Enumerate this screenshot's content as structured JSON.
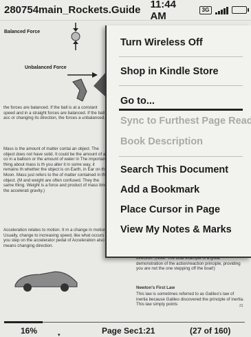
{
  "status": {
    "book_title": "280754main_Rockets.Guide",
    "time": "11:44 AM",
    "network_label": "3G"
  },
  "page": {
    "balanced_label": "Balanced Force",
    "unbalanced_label": "Unbalanced Force",
    "left_paragraphs": [
      "the forces are balanced. If the ball is at a constant speed and in a straight forces are balanced. If the ball is acc or changing its direction, the forces a unbalanced.",
      "Mass is the amount of matter contai an object. The object does not have solid. It could be the amount of air co in a balloon or the amount of water in The important thing about mass is th you alter it in some way, it remains th whether the object is on Earth, in Ear on the Moon. Mass just refers to the of matter contained in the object. (M and weight are often confused. They the same thing. Weight is a force and product of mass times the accelerati gravity.)",
      "Acceleration relates to motion. It m a change in motion. Usually, change to increasing speed, like what occurs you step on the accelerator pedal of Acceleration also means changing direction."
    ],
    "right_paragraph": "direction. (Note: The boat example is a great demonstration of the action/reaction principle, providing you are not the one stepping off the boat!)",
    "law_heading": "Newton's First Law",
    "law_text": "This law is sometimes referred to as Galileo's law of inertia because Galileo discovered the principle of inertia. This law simply points",
    "page_number": "21"
  },
  "menu": {
    "items": [
      {
        "label": "Turn Wireless Off",
        "enabled": true
      },
      {
        "label": "Shop in Kindle Store",
        "enabled": true
      },
      {
        "label": "Go to...",
        "enabled": true
      },
      {
        "label": "Sync to Furthest Page Read",
        "enabled": false
      },
      {
        "label": "Book Description",
        "enabled": false
      },
      {
        "label": "Search This Document",
        "enabled": true
      },
      {
        "label": "Add a Bookmark",
        "enabled": true
      },
      {
        "label": "Place Cursor in Page",
        "enabled": true
      },
      {
        "label": "View My Notes & Marks",
        "enabled": true
      }
    ]
  },
  "footer": {
    "percent": "16%",
    "progress_fraction": 0.16,
    "location": "Page Sec1:21",
    "pages": "(27 of 160)"
  }
}
